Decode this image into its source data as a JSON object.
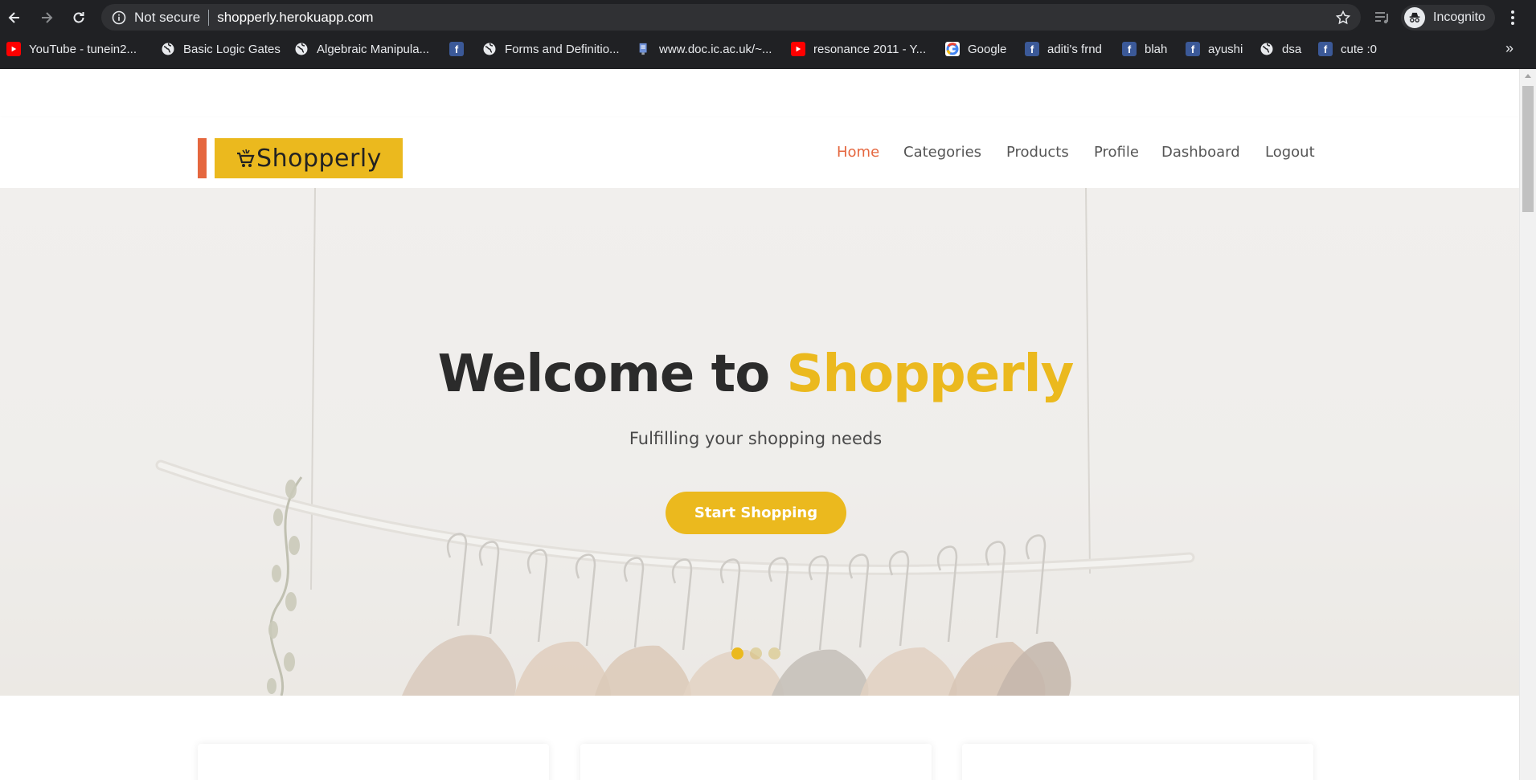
{
  "browser": {
    "security_label": "Not secure",
    "url": "shopperly.herokuapp.com",
    "profile_label": "Incognito",
    "bookmarks": [
      {
        "label": "YouTube - tunein2...",
        "icon": "youtube-icon"
      },
      {
        "label": "Basic Logic Gates",
        "icon": "globe-icon"
      },
      {
        "label": "Algebraic Manipula...",
        "icon": "globe-icon"
      },
      {
        "label": "",
        "icon": "facebook-icon"
      },
      {
        "label": "Forms and Definitio...",
        "icon": "globe-icon"
      },
      {
        "label": "www.doc.ic.ac.uk/~...",
        "icon": "document-icon"
      },
      {
        "label": "resonance 2011 - Y...",
        "icon": "youtube-icon"
      },
      {
        "label": "Google",
        "icon": "google-icon"
      },
      {
        "label": "aditi's frnd",
        "icon": "facebook-icon"
      },
      {
        "label": "blah",
        "icon": "facebook-icon"
      },
      {
        "label": "ayushi",
        "icon": "facebook-icon"
      },
      {
        "label": "dsa",
        "icon": "globe-icon"
      },
      {
        "label": "cute :0",
        "icon": "facebook-icon"
      }
    ],
    "more_bookmarks": "»"
  },
  "site": {
    "logo_text": "Shopperly",
    "nav": [
      {
        "label": "Home",
        "active": true
      },
      {
        "label": "Categories",
        "active": false
      },
      {
        "label": "Products",
        "active": false
      },
      {
        "label": "Profile",
        "active": false
      },
      {
        "label": "Dashboard",
        "active": false
      },
      {
        "label": "Logout",
        "active": false
      }
    ],
    "hero": {
      "title_prefix": "Welcome to ",
      "title_brand": "Shopperly",
      "subtitle": "Fulfilling your shopping needs",
      "cta_label": "Start Shopping",
      "slides_total": 3,
      "active_slide": 1
    }
  },
  "colors": {
    "accent": "#ebb91e",
    "accent_secondary": "#e5673f",
    "chrome_bg": "#202124"
  }
}
